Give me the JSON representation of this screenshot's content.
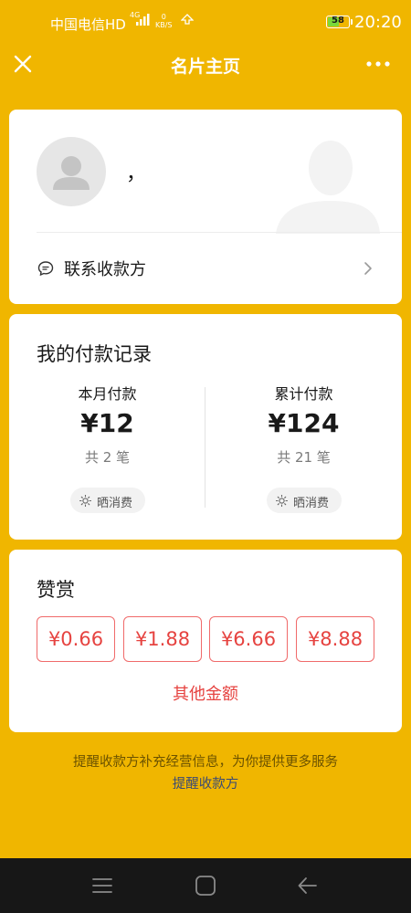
{
  "status_bar": {
    "carrier": "中国电信HD",
    "network": "4G",
    "speed_value": "0",
    "speed_unit": "KB/S",
    "battery": "58",
    "time": "20:20",
    "battery_level_percent": 58
  },
  "header": {
    "title": "名片主页",
    "close_icon": "close-icon",
    "more_icon": "more-icon"
  },
  "profile": {
    "nickname": "，",
    "contact_label": "联系收款方"
  },
  "payments": {
    "title": "我的付款记录",
    "stats": [
      {
        "label": "本月付款",
        "amount": "¥12",
        "count": "共 2 笔",
        "share": "晒消费"
      },
      {
        "label": "累计付款",
        "amount": "¥124",
        "count": "共 21 笔",
        "share": "晒消费"
      }
    ]
  },
  "tip": {
    "title": "赞赏",
    "amounts": [
      "¥0.66",
      "¥1.88",
      "¥6.66",
      "¥8.88"
    ],
    "other": "其他金额"
  },
  "footer": {
    "text": "提醒收款方补充经营信息，为你提供更多服务",
    "link": "提醒收款方"
  },
  "colors": {
    "background": "#F0B600",
    "accent_red": "#E64340"
  }
}
